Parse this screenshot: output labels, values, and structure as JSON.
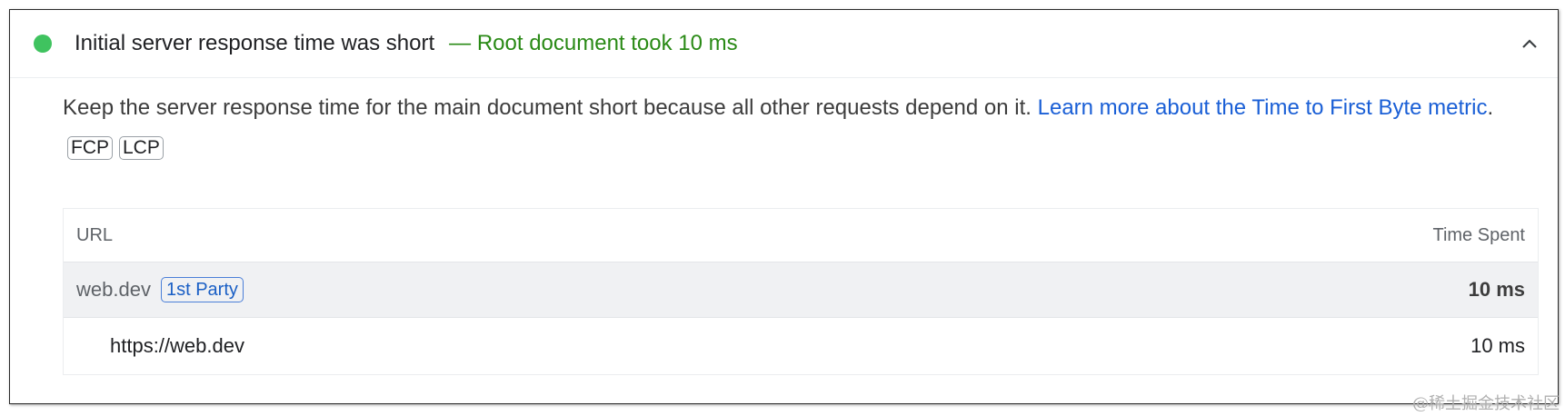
{
  "audit": {
    "status_color": "#3fc35f",
    "title": "Initial server response time was short",
    "summary": "— Root document took 10 ms",
    "summary_color": "#2a8a16",
    "expanded_icon": "chevron-up-icon",
    "description": {
      "text": "Keep the server response time for the main document short because all other requests depend on it. ",
      "link_text": "Learn more about the Time to First Byte metric",
      "link_color": "#1a5fd6",
      "suffix": ".",
      "chips": [
        "FCP",
        "LCP"
      ]
    },
    "table": {
      "headers": {
        "url": "URL",
        "time": "Time Spent"
      },
      "group": {
        "url": "web.dev",
        "badge": "1st Party",
        "time": "10 ms"
      },
      "items": [
        {
          "url": "https://web.dev",
          "time": "10 ms"
        }
      ]
    }
  },
  "watermark": "@稀土掘金技术社区"
}
